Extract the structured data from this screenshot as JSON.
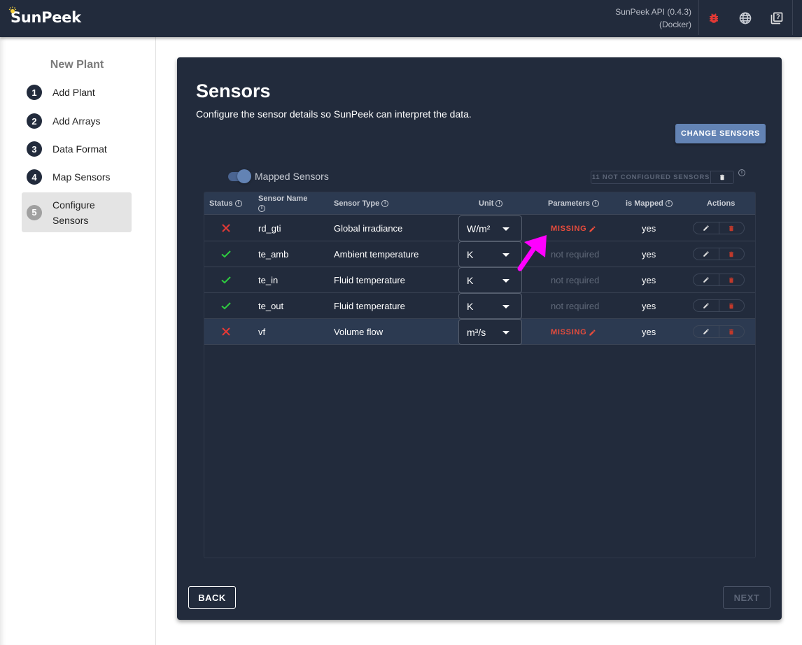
{
  "app": {
    "logo": "SunPeek",
    "api_line1": "SunPeek API (0.4.3)",
    "api_line2": "(Docker)",
    "icons": [
      "bug-icon",
      "globe-icon",
      "help-docs-icon"
    ],
    "colors": {
      "appbar": "#222b3c",
      "accent": "#6383b4",
      "error": "#e74c3c",
      "ok": "#2ecc40"
    }
  },
  "sidebar": {
    "title": "New Plant",
    "steps": [
      {
        "num": "1",
        "label": "Add Plant"
      },
      {
        "num": "2",
        "label": "Add Arrays"
      },
      {
        "num": "3",
        "label": "Data Format"
      },
      {
        "num": "4",
        "label": "Map Sensors"
      },
      {
        "num": "5",
        "label": "Configure Sensors",
        "active": true
      }
    ]
  },
  "main": {
    "title": "Sensors",
    "subtitle": "Configure the sensor details so SunPeek can interpret the data.",
    "change_sensors_label": "CHANGE SENSORS",
    "toggle_label": "Mapped Sensors",
    "toggle_on": true,
    "not_configured_label": "11 NOT CONFIGURED SENSORS",
    "table": {
      "headers": {
        "status": "Status",
        "sensor_name": "Sensor Name",
        "sensor_type": "Sensor Type",
        "unit": "Unit",
        "parameters": "Parameters",
        "is_mapped": "is Mapped",
        "actions": "Actions"
      },
      "rows": [
        {
          "status": "error",
          "name": "rd_gti",
          "type": "Global irradiance",
          "unit": "W/m²",
          "parameters": "MISSING",
          "param_state": "missing",
          "mapped": "yes"
        },
        {
          "status": "ok",
          "name": "te_amb",
          "type": "Ambient temperature",
          "unit": "K",
          "parameters": "not required",
          "param_state": "not_required",
          "mapped": "yes"
        },
        {
          "status": "ok",
          "name": "te_in",
          "type": "Fluid temperature",
          "unit": "K",
          "parameters": "not required",
          "param_state": "not_required",
          "mapped": "yes"
        },
        {
          "status": "ok",
          "name": "te_out",
          "type": "Fluid temperature",
          "unit": "K",
          "parameters": "not required",
          "param_state": "not_required",
          "mapped": "yes"
        },
        {
          "status": "error",
          "name": "vf",
          "type": "Volume flow",
          "unit": "m³/s",
          "parameters": "MISSING",
          "param_state": "missing",
          "mapped": "yes",
          "highlighted": true
        }
      ]
    },
    "back_label": "BACK",
    "next_label": "NEXT"
  }
}
